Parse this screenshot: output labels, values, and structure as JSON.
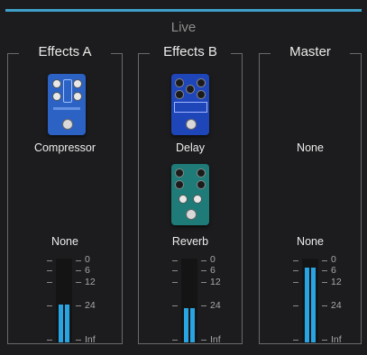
{
  "title": "Live",
  "accent": "#3fa1c9",
  "meter_color": "#27a4e1",
  "panels": [
    {
      "name": "Effects A",
      "slot1": "Compressor",
      "slot2": "None",
      "meter": {
        "levels": [
          0.45,
          0.45
        ]
      }
    },
    {
      "name": "Effects B",
      "slot1": "Delay",
      "slot2": "Reverb",
      "meter": {
        "levels": [
          0.41,
          0.41
        ]
      }
    },
    {
      "name": "Master",
      "slot1": "None",
      "slot2": "None",
      "meter": {
        "levels": [
          0.89,
          0.89
        ]
      }
    }
  ],
  "scale": [
    "0",
    "6",
    "12",
    "24",
    "Inf"
  ],
  "pedals": {
    "compressor": {
      "color": "#2b62c4",
      "icon": "compressor-pedal-icon"
    },
    "delay": {
      "color": "#1f46b8",
      "icon": "delay-pedal-icon"
    },
    "reverb": {
      "color": "#1e7b78",
      "icon": "reverb-pedal-icon"
    }
  }
}
